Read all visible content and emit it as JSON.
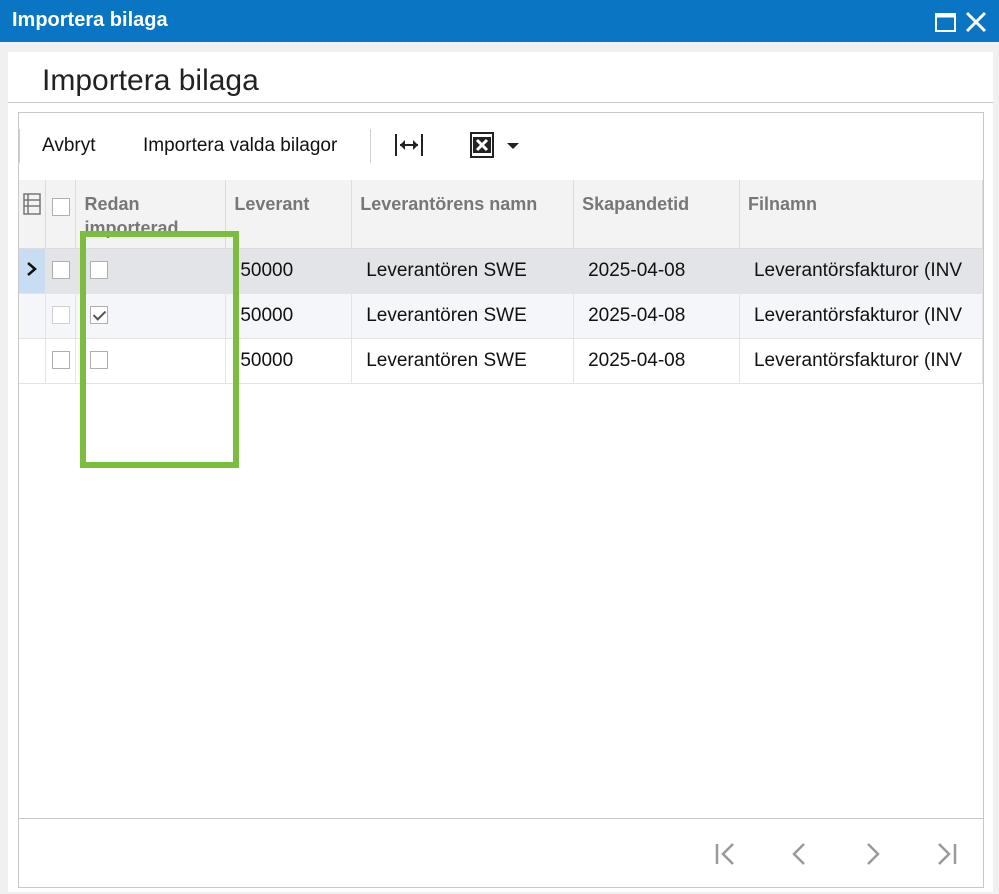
{
  "window": {
    "title": "Importera bilaga",
    "maximize_icon": "maximize-icon",
    "close_icon": "close-icon"
  },
  "header": {
    "title": "Importera bilaga"
  },
  "toolbar": {
    "cancel_label": "Avbryt",
    "import_label": "Importera valda bilagor",
    "fit_columns_icon": "fit-columns-icon",
    "export_excel_icon": "excel-export-icon"
  },
  "grid": {
    "columns": [
      "Redan importerad",
      "Leverant",
      "Leverantörens namn",
      "Skapandetid",
      "Filnamn"
    ],
    "rows": [
      {
        "redan_importerad": false,
        "leverantor": "50000",
        "namn": "Leverantören SWE",
        "skapandetid": "2025-04-08",
        "filnamn": "Leverantörsfakturor (INV",
        "active": true
      },
      {
        "redan_importerad": true,
        "leverantor": "50000",
        "namn": "Leverantören SWE",
        "skapandetid": "2025-04-08",
        "filnamn": "Leverantörsfakturor (INV",
        "active": false
      },
      {
        "redan_importerad": false,
        "leverantor": "50000",
        "namn": "Leverantören SWE",
        "skapandetid": "2025-04-08",
        "filnamn": "Leverantörsfakturor (INV",
        "active": false
      }
    ]
  },
  "pager": {
    "first_icon": "first-page-icon",
    "prev_icon": "previous-page-icon",
    "next_icon": "next-page-icon",
    "last_icon": "last-page-icon"
  },
  "colors": {
    "titlebar": "#0a75c2",
    "highlight": "#7bbd3f",
    "active_row": "#e2e4e7"
  }
}
